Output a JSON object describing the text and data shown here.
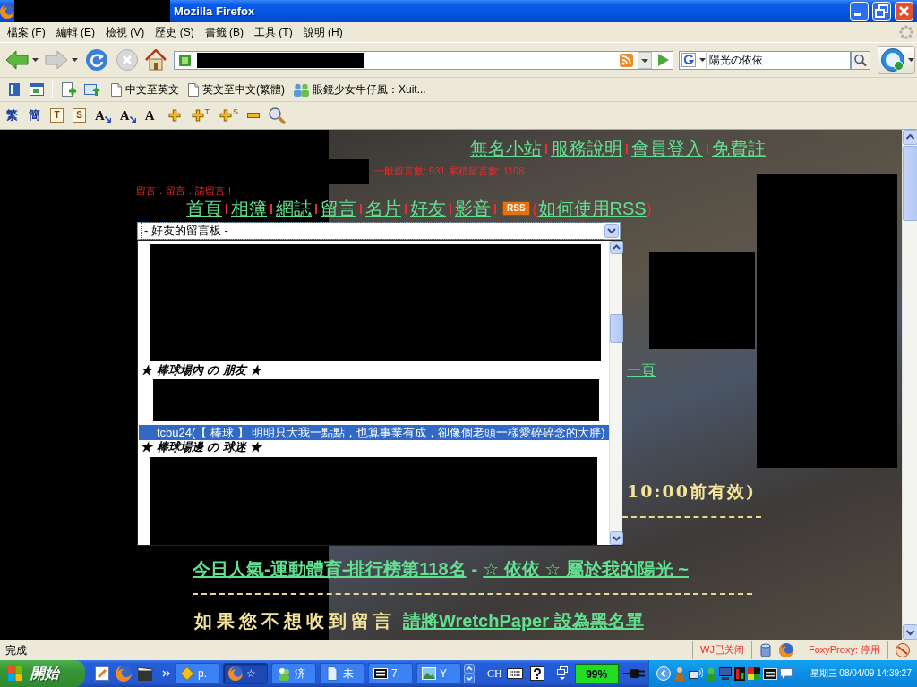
{
  "window": {
    "title": "Mozilla Firefox"
  },
  "menu": [
    "檔案 (F)",
    "編輯 (E)",
    "檢視 (V)",
    "歷史 (S)",
    "書籤 (B)",
    "工具 (T)",
    "說明 (H)"
  ],
  "search": {
    "value": "陽光の依依"
  },
  "bookmarks": [
    {
      "label": "中文至英文",
      "kind": "page"
    },
    {
      "label": "英文至中文(繁體)",
      "kind": "page"
    },
    {
      "label": "眼鏡少女牛仔風：Xuit...",
      "kind": "group"
    }
  ],
  "tools": [
    {
      "kind": "glyph",
      "label": "繁"
    },
    {
      "kind": "glyph",
      "label": "簡"
    },
    {
      "kind": "sheet",
      "label": "T"
    },
    {
      "kind": "sheet",
      "label": "S"
    },
    {
      "kind": "size",
      "label": "A"
    },
    {
      "kind": "size",
      "label": "A"
    },
    {
      "kind": "letter",
      "label": "A"
    },
    {
      "kind": "plus"
    },
    {
      "kind": "plus",
      "label": "T"
    },
    {
      "kind": "plus",
      "label": "S"
    },
    {
      "kind": "minus"
    },
    {
      "kind": "wrench"
    }
  ],
  "page": {
    "top_links": [
      "無名小站",
      "服務說明",
      "會員登入",
      "免費註"
    ],
    "message_counts": "一般留言數: 931 累積留言數: 1108",
    "prompt": "留言．留言．請留言！",
    "nav_links": [
      "首頁",
      "相簿",
      "網誌",
      "留言",
      "名片",
      "好友",
      "影音"
    ],
    "rss": {
      "badge": "RSS",
      "open": "(",
      "link": "如何使用RSS",
      "close": ")"
    },
    "board_select": {
      "value": "- 好友的留言板 -"
    },
    "board_options": [
      {
        "kind": "redacted"
      },
      {
        "kind": "heading",
        "label": "★ 棒球場內 の 朋友 ★"
      },
      {
        "kind": "redacted"
      },
      {
        "kind": "option",
        "label": "tcbu24(【 棒球 】 明明只大我一點點，也算事業有成，卻像個老頭一樣愛碎碎念的大胖)",
        "selected": true
      },
      {
        "kind": "heading",
        "label": "★ 棒球場邊 の 球迷 ★"
      },
      {
        "kind": "redacted"
      }
    ],
    "next_page": "一頁",
    "deadline": "10:00前有效)",
    "ranking_links": [
      "今日人氣-運動體育-排行榜第118名",
      "☆ 依依 ☆ 屬於我的陽光 ~"
    ],
    "ranking_joiner": "-",
    "blacklist": {
      "text": "如果您不想收到留言",
      "link": "請將WretchPaper 設為黑名單"
    }
  },
  "status_bar": {
    "text": "完成",
    "indicators": [
      {
        "label": "WJ已关闭"
      },
      {
        "label": "FoxyProxy: 停用"
      }
    ]
  },
  "taskbar": {
    "start": "開始",
    "tasks": [
      {
        "label": "p.",
        "kind": "diamond",
        "selected": false
      },
      {
        "label": "☆",
        "kind": "globe",
        "selected": true
      },
      {
        "label": "济",
        "kind": "people",
        "selected": false
      },
      {
        "label": "未",
        "kind": "document",
        "selected": false
      },
      {
        "label": "7.",
        "kind": "archive",
        "selected": false
      },
      {
        "label": "Y",
        "kind": "picture",
        "selected": false
      }
    ],
    "ime": "CH",
    "battery": "99%",
    "clock": "星期三 08/04/09 14:39:27"
  }
}
